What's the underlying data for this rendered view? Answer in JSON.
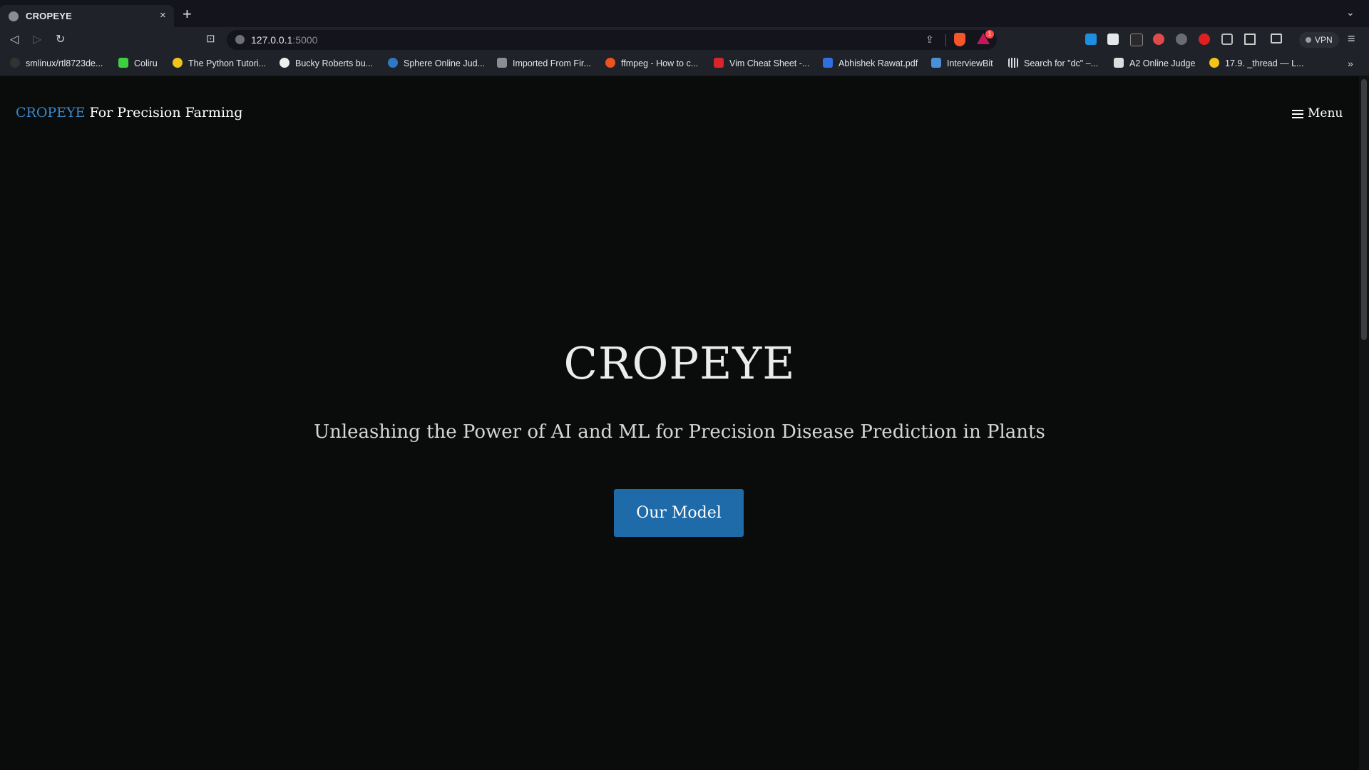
{
  "browser": {
    "tab": {
      "title": "CROPEYE",
      "close_glyph": "×"
    },
    "new_tab_glyph": "+",
    "tab_list_glyph": "⌄",
    "url": {
      "host": "127.0.0.1",
      "port": ":5000"
    },
    "vpn_label": "VPN",
    "bookmarks": [
      {
        "label": "smlinux/rtl8723de...",
        "icon": "github-icon",
        "color": "#333333"
      },
      {
        "label": "Coliru",
        "icon": "coliru-icon",
        "color": "#3ecf3e"
      },
      {
        "label": "The Python Tutori...",
        "icon": "python-icon",
        "color": "#f0c419"
      },
      {
        "label": "Bucky Roberts bu...",
        "icon": "github-icon",
        "color": "#eeeeee"
      },
      {
        "label": "Sphere Online Jud...",
        "icon": "spoj-icon",
        "color": "#2f78c4"
      },
      {
        "label": "Imported From Fir...",
        "icon": "folder-icon",
        "color": "#8a8d96"
      },
      {
        "label": "ffmpeg - How to c...",
        "icon": "askubuntu-icon",
        "color": "#e95420"
      },
      {
        "label": "Vim Cheat Sheet -...",
        "icon": "vim-icon",
        "color": "#d9232d"
      },
      {
        "label": "Abhishek Rawat.pdf",
        "icon": "dropbox-icon",
        "color": "#2f6fe0"
      },
      {
        "label": "InterviewBit",
        "icon": "interviewbit-icon",
        "color": "#4a90d9"
      },
      {
        "label": "Search for \"dc\" –...",
        "icon": "barcode-icon",
        "color": "#dddddd"
      },
      {
        "label": "A2 Online Judge",
        "icon": "a2-icon",
        "color": "#dddddd"
      },
      {
        "label": "17.9. _thread — L...",
        "icon": "python-icon",
        "color": "#f0c419"
      }
    ],
    "bookmarks_more_glyph": "»",
    "rewards_badge": "1"
  },
  "page": {
    "brand_name": "CROPEYE",
    "brand_tagline": "For Precision Farming",
    "menu_label": "Menu",
    "hero_title": "CROPEYE",
    "hero_subtitle": "Unleashing the Power of AI and ML for Precision Disease Prediction in Plants",
    "cta_label": "Our Model"
  },
  "colors": {
    "background": "#0a0c0c",
    "brand_accent": "#3a86c8",
    "cta": "#1f6aa8"
  }
}
